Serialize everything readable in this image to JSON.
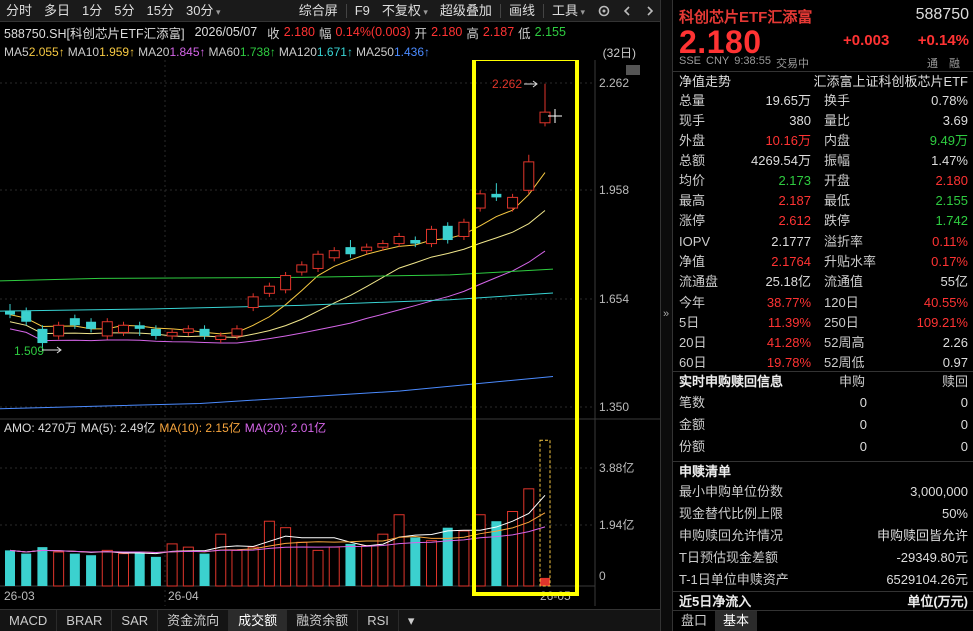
{
  "toolbar": {
    "left": [
      "分时",
      "多日",
      "1分",
      "5分",
      "15分",
      "30分"
    ],
    "right": [
      "综合屏",
      "F9",
      "不复权",
      "超级叠加",
      "画线",
      "工具"
    ]
  },
  "info": {
    "code_name": "588750.SH[科创芯片ETF汇添富]",
    "date": "2026/05/07",
    "close_label": "收",
    "close": "2.180",
    "change_label": "幅",
    "change": "0.14%(0.003)",
    "open_label": "开",
    "open": "2.180",
    "high_label": "高",
    "high": "2.187",
    "low_label": "低",
    "low": "2.155"
  },
  "ma": {
    "ma5": "MA5 ",
    "ma5_v": "2.055↑",
    "ma10": "MA10 ",
    "ma10_v": "1.959↑",
    "ma20": "MA20 ",
    "ma20_v": "1.845↑",
    "ma60": "MA60 ",
    "ma60_v": "1.738↑",
    "ma120": "MA120 ",
    "ma120_v": "1.671↑",
    "ma250": "MA250 ",
    "ma250_v": "1.436↑",
    "period": "(32日)"
  },
  "axis": {
    "p1": "2.262",
    "p2": "1.958",
    "p3": "1.654",
    "p4": "1.350",
    "v1": "3.88亿",
    "v2": "1.94亿",
    "v3": "0",
    "d1": "26-03",
    "d2": "26-04",
    "d3": "26-05",
    "hi_marker": "2.262",
    "lo_marker": "1.509"
  },
  "amo": {
    "amo": "AMO: 4270万",
    "ma5": "MA(5): 2.49亿",
    "ma10": "MA(10): 2.15亿",
    "ma20": "MA(20): 2.01亿"
  },
  "bottom_tabs": [
    "MACD",
    "BRAR",
    "SAR",
    "资金流向",
    "成交额",
    "融资余额",
    "RSI"
  ],
  "panel": {
    "title": "科创芯片ETF汇添富",
    "code": "588750",
    "price": "2.180",
    "change": "+0.003",
    "change_pct": "+0.14%",
    "sub": [
      "SSE",
      "CNY",
      "9:38:55",
      "交易中"
    ],
    "tong": "通",
    "bo": "融",
    "nav_trend": "净值走势",
    "fund_full": "汇添富上证科创板芯片ETF",
    "rows": [
      [
        "总量",
        "19.65万",
        "换手",
        "0.78%"
      ],
      [
        "现手",
        "380",
        "量比",
        "3.69"
      ],
      [
        "外盘",
        "10.16万",
        "内盘",
        "9.49万"
      ],
      [
        "总额",
        "4269.54万",
        "振幅",
        "1.47%"
      ],
      [
        "均价",
        "2.173",
        "开盘",
        "2.180"
      ],
      [
        "最高",
        "2.187",
        "最低",
        "2.155"
      ],
      [
        "涨停",
        "2.612",
        "跌停",
        "1.742"
      ],
      [
        "IOPV",
        "2.1777",
        "溢折率",
        "0.11%"
      ],
      [
        "净值",
        "2.1764",
        "升贴水率",
        "0.17%"
      ],
      [
        "流通盘",
        "25.18亿",
        "流通值",
        "55亿"
      ],
      [
        "今年",
        "38.77%",
        "120日",
        "40.55%"
      ],
      [
        "5日",
        "11.39%",
        "250日",
        "109.21%"
      ],
      [
        "20日",
        "41.28%",
        "52周高",
        "2.26"
      ],
      [
        "60日",
        "19.78%",
        "52周低",
        "0.97"
      ]
    ],
    "sg_header": [
      "实时申购赎回信息",
      "申购",
      "赎回"
    ],
    "sg_rows": [
      [
        "笔数",
        "0",
        "0"
      ],
      [
        "金额",
        "0",
        "0"
      ],
      [
        "份额",
        "0",
        "0"
      ]
    ],
    "list_header": "申赎清单",
    "list_rows": [
      [
        "最小申购单位份数",
        "3,000,000"
      ],
      [
        "现金替代比例上限",
        "50%"
      ],
      [
        "申购赎回允许情况",
        "申购赎回皆允许"
      ],
      [
        "T日预估现金差额",
        "-29349.80元"
      ],
      [
        "T-1日单位申赎资产",
        "6529104.26元"
      ]
    ],
    "flow_label": "近5日净流入",
    "flow_unit": "单位(万元)",
    "tabs": [
      "盘口",
      "基本"
    ]
  },
  "chart_data": {
    "type": "candlestick",
    "y_range": [
      1.35,
      2.262
    ],
    "candles": [
      {
        "o": 1.62,
        "c": 1.61,
        "h": 1.64,
        "l": 1.6
      },
      {
        "o": 1.62,
        "c": 1.59,
        "h": 1.63,
        "l": 1.58
      },
      {
        "o": 1.57,
        "c": 1.53,
        "h": 1.58,
        "l": 1.51
      },
      {
        "o": 1.55,
        "c": 1.58,
        "h": 1.59,
        "l": 1.54
      },
      {
        "o": 1.6,
        "c": 1.58,
        "h": 1.61,
        "l": 1.57
      },
      {
        "o": 1.59,
        "c": 1.57,
        "h": 1.6,
        "l": 1.56
      },
      {
        "o": 1.55,
        "c": 1.59,
        "h": 1.6,
        "l": 1.54
      },
      {
        "o": 1.56,
        "c": 1.58,
        "h": 1.59,
        "l": 1.55
      },
      {
        "o": 1.58,
        "c": 1.57,
        "h": 1.59,
        "l": 1.55
      },
      {
        "o": 1.57,
        "c": 1.55,
        "h": 1.58,
        "l": 1.54
      },
      {
        "o": 1.55,
        "c": 1.56,
        "h": 1.57,
        "l": 1.54
      },
      {
        "o": 1.56,
        "c": 1.57,
        "h": 1.58,
        "l": 1.55
      },
      {
        "o": 1.57,
        "c": 1.55,
        "h": 1.58,
        "l": 1.54
      },
      {
        "o": 1.54,
        "c": 1.55,
        "h": 1.56,
        "l": 1.53
      },
      {
        "o": 1.55,
        "c": 1.57,
        "h": 1.58,
        "l": 1.54
      },
      {
        "o": 1.63,
        "c": 1.66,
        "h": 1.67,
        "l": 1.62
      },
      {
        "o": 1.67,
        "c": 1.69,
        "h": 1.7,
        "l": 1.66
      },
      {
        "o": 1.68,
        "c": 1.72,
        "h": 1.73,
        "l": 1.67
      },
      {
        "o": 1.73,
        "c": 1.75,
        "h": 1.76,
        "l": 1.72
      },
      {
        "o": 1.74,
        "c": 1.78,
        "h": 1.79,
        "l": 1.73
      },
      {
        "o": 1.77,
        "c": 1.79,
        "h": 1.8,
        "l": 1.76
      },
      {
        "o": 1.8,
        "c": 1.78,
        "h": 1.82,
        "l": 1.77
      },
      {
        "o": 1.79,
        "c": 1.8,
        "h": 1.81,
        "l": 1.78
      },
      {
        "o": 1.8,
        "c": 1.81,
        "h": 1.82,
        "l": 1.79
      },
      {
        "o": 1.81,
        "c": 1.83,
        "h": 1.84,
        "l": 1.8
      },
      {
        "o": 1.82,
        "c": 1.81,
        "h": 1.83,
        "l": 1.8
      },
      {
        "o": 1.81,
        "c": 1.85,
        "h": 1.86,
        "l": 1.8
      },
      {
        "o": 1.86,
        "c": 1.82,
        "h": 1.87,
        "l": 1.81
      },
      {
        "o": 1.83,
        "c": 1.87,
        "h": 1.88,
        "l": 1.82
      },
      {
        "o": 1.91,
        "c": 1.95,
        "h": 1.96,
        "l": 1.9
      },
      {
        "o": 1.95,
        "c": 1.94,
        "h": 1.98,
        "l": 1.93
      },
      {
        "o": 1.91,
        "c": 1.94,
        "h": 1.95,
        "l": 1.9
      },
      {
        "o": 1.96,
        "c": 2.04,
        "h": 2.06,
        "l": 1.95
      },
      {
        "o": 2.15,
        "c": 2.18,
        "h": 2.26,
        "l": 2.14
      }
    ],
    "volume": [
      1.1,
      1.0,
      1.2,
      1.05,
      1.0,
      0.95,
      1.1,
      1.0,
      1.05,
      0.9,
      1.3,
      1.2,
      1.0,
      1.6,
      1.1,
      1.2,
      2.0,
      1.8,
      1.35,
      1.1,
      1.2,
      1.3,
      1.25,
      1.6,
      2.2,
      1.5,
      1.4,
      1.8,
      1.7,
      2.2,
      2.0,
      2.3,
      3.0,
      4.5
    ],
    "volume_range": [
      0,
      4.6
    ]
  }
}
